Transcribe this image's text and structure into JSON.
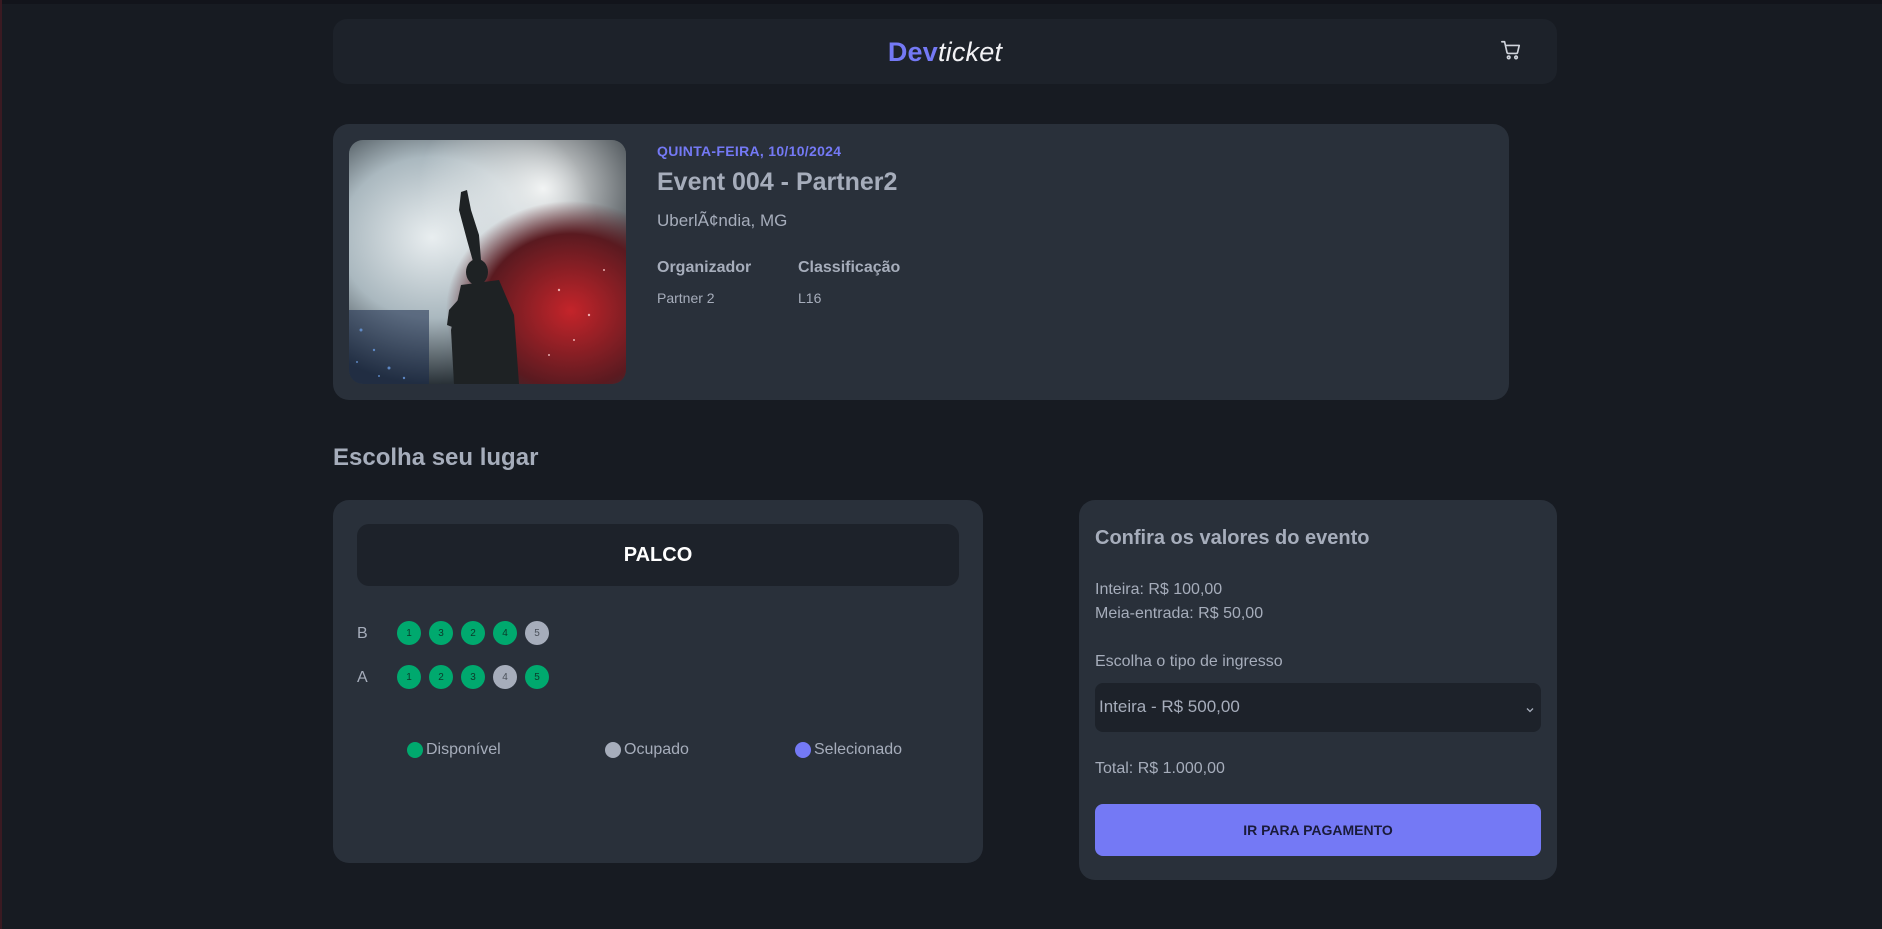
{
  "header": {
    "logo_dev": "Dev",
    "logo_ticket": "ticket"
  },
  "event": {
    "date": "QUINTA-FEIRA, 10/10/2024",
    "title": "Event 004 - Partner2",
    "location": "UberlÃ¢ndia, MG",
    "organizer_label": "Organizador",
    "organizer_value": "Partner 2",
    "rating_label": "Classificação",
    "rating_value": "L16"
  },
  "section_title": "Escolha seu lugar",
  "seatmap": {
    "stage_label": "PALCO",
    "rows": [
      {
        "label": "B",
        "seats": [
          {
            "number": "1",
            "status": "free"
          },
          {
            "number": "3",
            "status": "free"
          },
          {
            "number": "2",
            "status": "free"
          },
          {
            "number": "4",
            "status": "free"
          },
          {
            "number": "5",
            "status": "taken"
          }
        ]
      },
      {
        "label": "A",
        "seats": [
          {
            "number": "1",
            "status": "free"
          },
          {
            "number": "2",
            "status": "free"
          },
          {
            "number": "3",
            "status": "free"
          },
          {
            "number": "4",
            "status": "taken"
          },
          {
            "number": "5",
            "status": "free"
          }
        ]
      }
    ],
    "legend": {
      "available": "Disponível",
      "occupied": "Ocupado",
      "selected": "Selecionado"
    }
  },
  "prices": {
    "title": "Confira os valores do evento",
    "full": "Inteira: R$ 100,00",
    "half": "Meia-entrada: R$ 50,00",
    "ticket_type_label": "Escolha o tipo de ingresso",
    "ticket_type_selected": "Inteira - R$ 500,00",
    "total": "Total: R$ 1.000,00",
    "pay_button": "IR PARA PAGAMENTO"
  },
  "colors": {
    "accent": "#7479f5",
    "available": "#00a96e",
    "occupied": "#a6adbb",
    "selected": "#7479f5"
  },
  "icons": {
    "cart": "cart-icon",
    "chevron": "chevron-down-icon"
  }
}
